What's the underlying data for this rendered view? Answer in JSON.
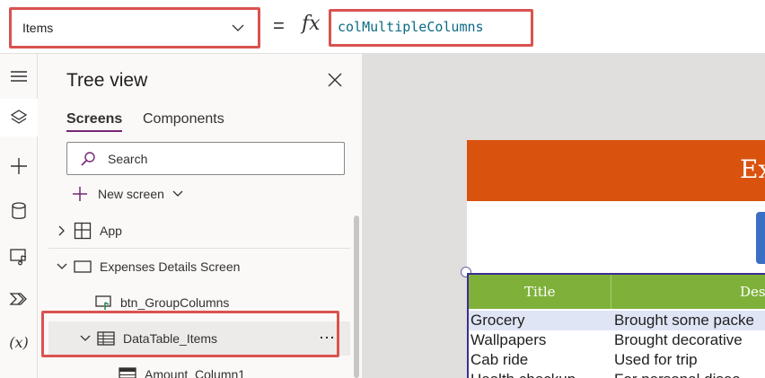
{
  "formula_bar": {
    "property": "Items",
    "equals": "=",
    "fx": "fx",
    "formula": "colMultipleColumns"
  },
  "rail": {
    "items": [
      {
        "icon": "hamburger-menu-icon"
      },
      {
        "icon": "layers-icon",
        "active": true
      },
      {
        "icon": "insert-plus-icon"
      },
      {
        "icon": "data-cylinder-icon"
      },
      {
        "icon": "media-icon"
      },
      {
        "icon": "power-automate-icon"
      },
      {
        "icon": "variables-icon",
        "label": "(x)"
      }
    ]
  },
  "tree_view": {
    "title": "Tree view",
    "tabs": {
      "screens": "Screens",
      "components": "Components"
    },
    "search_placeholder": "Search",
    "new_screen": "New screen",
    "nodes": {
      "app": "App",
      "screen": "Expenses Details Screen",
      "button": "btn_GroupColumns",
      "datatable": "DataTable_Items",
      "datatable_more": "⋯",
      "column": "Amount_Column1"
    }
  },
  "canvas": {
    "banner_text": "Ex",
    "table": {
      "headers": {
        "title": "Title",
        "description": "Desc"
      },
      "rows": [
        {
          "title": "Grocery",
          "description": "Brought some packe"
        },
        {
          "title": "Wallpapers",
          "description": "Brought decorative"
        },
        {
          "title": "Cab ride",
          "description": "Used for trip"
        },
        {
          "title": "Health checkup",
          "description": "For personal disea"
        }
      ]
    }
  },
  "colors": {
    "highlight": "#d9534f",
    "banner": "#d9530f",
    "table_header": "#7fb13a",
    "selected_tab": "#742774",
    "formula_text": "#0b6a84"
  }
}
